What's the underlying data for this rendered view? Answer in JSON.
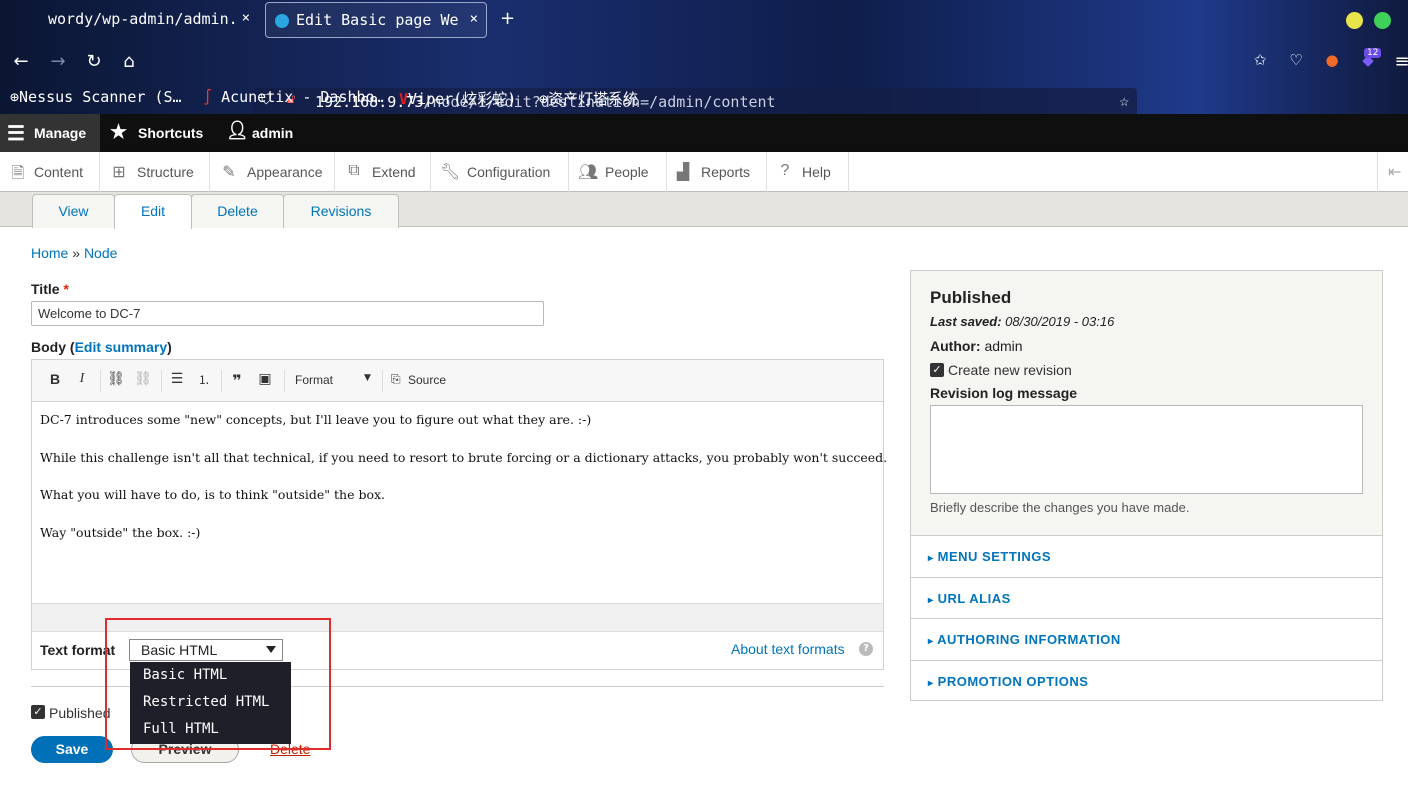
{
  "browser": {
    "tabs": [
      {
        "label": "wordy/wp-admin/admin.",
        "close": "×"
      },
      {
        "label": "Edit Basic page We",
        "close": "×"
      }
    ],
    "new_tab": "+",
    "url_host": "192.168.9.73",
    "url_path": "/node/1/edit?destination=/admin/content",
    "extension_badge": "12",
    "bookmarks": [
      "Nessus Scanner (S…",
      "Acunetix - Dashbo…",
      "Viper(炫彩蛇)",
      "资产灯塔系统"
    ]
  },
  "toolbar": {
    "manage": "Manage",
    "shortcuts": "Shortcuts",
    "user": "admin"
  },
  "admin_menu": [
    "Content",
    "Structure",
    "Appearance",
    "Extend",
    "Configuration",
    "People",
    "Reports",
    "Help"
  ],
  "page_tabs": [
    "View",
    "Edit",
    "Delete",
    "Revisions"
  ],
  "breadcrumb": {
    "home": "Home",
    "sep": "»",
    "node": "Node"
  },
  "form": {
    "title_label": "Title",
    "required_mark": "*",
    "title_value": "Welcome to DC-7",
    "body_label": "Body (",
    "edit_summary": "Edit summary",
    "body_label_end": ")",
    "editor_toolbar": {
      "bold": "B",
      "italic": "I",
      "format": "Format",
      "source": "Source"
    },
    "body_paragraphs": [
      "DC-7 introduces some \"new\" concepts, but I'll leave you to figure out what they are.  :-)",
      "While this challenge isn't all that technical, if you need to resort to brute forcing or a dictionary attacks, you probably won't succeed.",
      "What you will have to do, is to think \"outside\" the box.",
      "Way \"outside\" the box.  :-)"
    ],
    "text_format_label": "Text format",
    "text_format_selected": "Basic HTML",
    "text_format_options": [
      "Basic HTML",
      "Restricted HTML",
      "Full HTML"
    ],
    "about_text_formats": "About text formats",
    "help_icon": "?",
    "published_label": "Published",
    "save": "Save",
    "preview": "Preview",
    "delete": "Delete"
  },
  "sidebar": {
    "status": "Published",
    "last_saved_label": "Last saved:",
    "last_saved_value": "08/30/2019 - 03:16",
    "author_label": "Author:",
    "author_value": "admin",
    "create_revision": "Create new revision",
    "revision_log_label": "Revision log message",
    "revision_help": "Briefly describe the changes you have made.",
    "sections": [
      "MENU SETTINGS",
      "URL ALIAS",
      "AUTHORING INFORMATION",
      "PROMOTION OPTIONS"
    ],
    "section_marker": "▸"
  },
  "colors": {
    "link": "#0074bd",
    "save_button": "#0071b8",
    "highlight_box": "#e02c2c"
  }
}
